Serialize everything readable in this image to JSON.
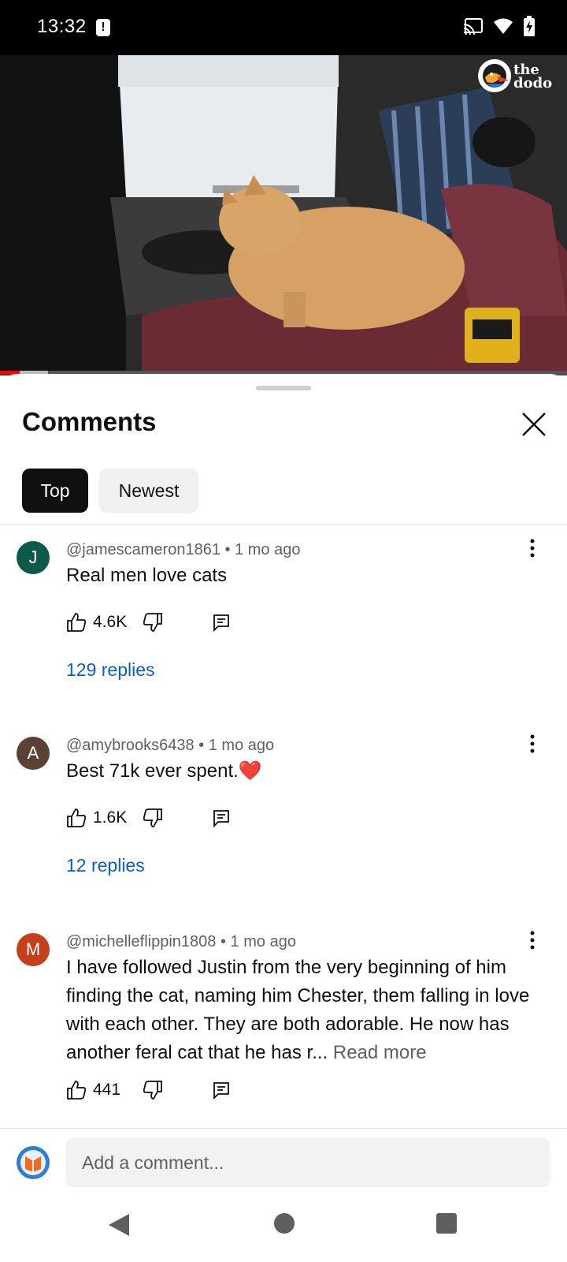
{
  "status_bar": {
    "time": "13:32",
    "icons": [
      "alert-icon",
      "cast-icon",
      "wifi-icon",
      "battery-charging-icon"
    ]
  },
  "video": {
    "watermark": "the dodo",
    "progress": 0.035,
    "buffered": 0.085
  },
  "comments_panel": {
    "title": "Comments",
    "tabs": [
      {
        "label": "Top",
        "selected": true
      },
      {
        "label": "Newest",
        "selected": false
      }
    ],
    "comments": [
      {
        "avatar_letter": "J",
        "avatar_color": "#0d5a4a",
        "author": "@jamescameron1861",
        "age": "1 mo ago",
        "text": "Real men love cats",
        "likes": "4.6K",
        "replies": "129 replies"
      },
      {
        "avatar_letter": "A",
        "avatar_color": "#5b4036",
        "author": "@amybrooks6438",
        "age": "1 mo ago",
        "text": "Best 71k ever spent.",
        "emoji": "❤️",
        "likes": "1.6K",
        "replies": "12 replies"
      },
      {
        "avatar_letter": "M",
        "avatar_color": "#c63e1a",
        "author": "@michelleflippin1808",
        "age": "1 mo ago",
        "text": "I have followed Justin from  the very beginning of him finding the cat, naming him Chester, them falling in love with each other. They are both adorable. He now has another feral cat that he has r...",
        "read_more": "Read more",
        "likes": "441"
      }
    ],
    "composer_placeholder": "Add a comment..."
  },
  "colors": {
    "accent_link": "#065fd4",
    "chip_selected": "#0f0f0f",
    "progress": "#ff0000"
  }
}
